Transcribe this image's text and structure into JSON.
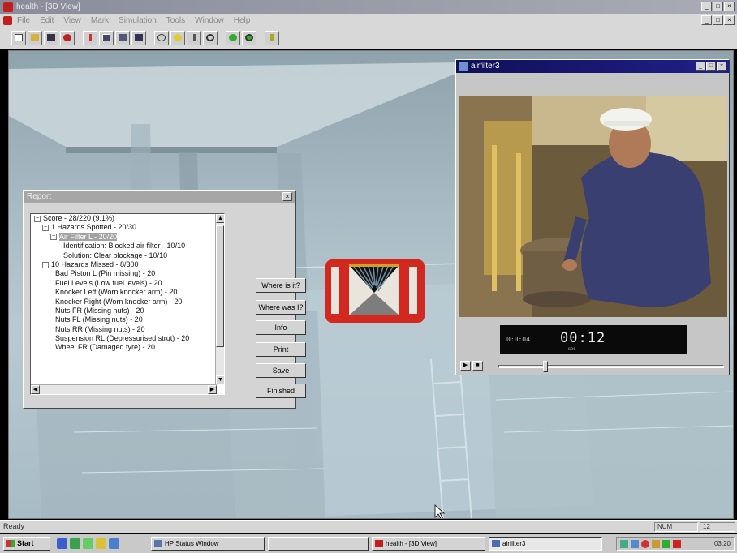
{
  "window": {
    "title": "health - [3D View]"
  },
  "menu": [
    "File",
    "Edit",
    "View",
    "Mark",
    "Simulation",
    "Tools",
    "Window",
    "Help"
  ],
  "report": {
    "title": "Report",
    "close_glyph": "×",
    "tree": [
      {
        "level": 0,
        "expander": "−",
        "text": "Score - 28/220 (9.1%)"
      },
      {
        "level": 1,
        "expander": "−",
        "text": "1 Hazards Spotted - 20/30"
      },
      {
        "level": 2,
        "expander": "−",
        "text": "Air Filter L - 20/20",
        "selected": true
      },
      {
        "level": 3,
        "expander": "",
        "text": "Identification: Blocked air filter - 10/10"
      },
      {
        "level": 3,
        "expander": "",
        "text": "Solution: Clear blockage - 10/10"
      },
      {
        "level": 1,
        "expander": "−",
        "text": "10 Hazards Missed - 8/300"
      },
      {
        "level": 2,
        "expander": "",
        "text": "Bad Piston L (Pin missing) - 20"
      },
      {
        "level": 2,
        "expander": "",
        "text": "Fuel Levels (Low fuel levels) - 20"
      },
      {
        "level": 2,
        "expander": "",
        "text": "Knocker Left (Worn knocker arm) - 20"
      },
      {
        "level": 2,
        "expander": "",
        "text": "Knocker Right (Worn knocker arm) - 20"
      },
      {
        "level": 2,
        "expander": "",
        "text": "Nuts FR (Missing nuts) - 20"
      },
      {
        "level": 2,
        "expander": "",
        "text": "Nuts FL (Missing nuts) - 20"
      },
      {
        "level": 2,
        "expander": "",
        "text": "Nuts RR (Missing nuts) - 20"
      },
      {
        "level": 2,
        "expander": "",
        "text": "Suspension RL (Depressurised strut) - 20"
      },
      {
        "level": 2,
        "expander": "",
        "text": "Wheel FR (Damaged tyre) - 20"
      }
    ],
    "buttons": [
      "Where is it?",
      "Where was I?",
      "Info",
      "Print",
      "Save",
      "Finished"
    ]
  },
  "player": {
    "title": "airfilter3",
    "counter_small": "0:0:04",
    "counter_big": "00:12",
    "counter_unit": "sec",
    "seek_progress": 0.2
  },
  "status": {
    "text": "Ready",
    "num": "NUM",
    "extra": "12"
  },
  "taskbar": {
    "start": "Start",
    "tasks": [
      "HP Status Window",
      "",
      "health - [3D View]",
      "airfilter3"
    ],
    "clock": "03:20"
  },
  "colors": {
    "hazard_red": "#d2281f",
    "title_active": "#10105a"
  }
}
